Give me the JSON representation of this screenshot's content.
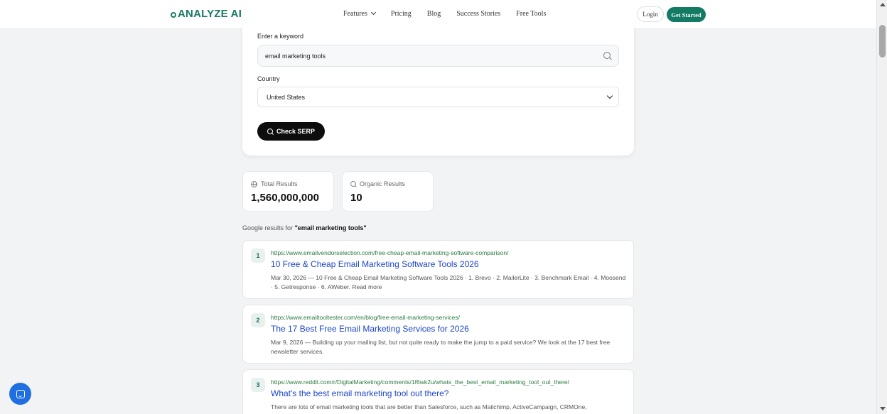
{
  "nav": {
    "logo": "ANALYZE AI",
    "links": [
      "Features",
      "Pricing",
      "Blog",
      "Success Stories",
      "Free Tools"
    ],
    "login": "Login",
    "get_started": "Get Started"
  },
  "form": {
    "keyword_label": "Enter a keyword",
    "keyword_value": "email marketing tools",
    "country_label": "Country",
    "country_value": "United States",
    "submit": "Check SERP"
  },
  "stats": {
    "total_label": "Total Results",
    "total_value": "1,560,000,000",
    "organic_label": "Organic Results",
    "organic_value": "10"
  },
  "results_caption": {
    "prefix": "Google results for",
    "query": "\"email marketing tools\""
  },
  "results": [
    {
      "rank": "1",
      "url": "https://www.emailvendorselection.com/free-cheap-email-marketing-software-comparison/",
      "title": "10 Free & Cheap Email Marketing Software Tools 2026",
      "snippet": "Mar 30, 2026 — 10 Free & Cheap Email Marketing Software Tools 2026 · 1. Brevo · 2. MailerLite · 3. Benchmark Email · 4. Moosend · 5. Getresponse · 6. AWeber. Read more"
    },
    {
      "rank": "2",
      "url": "https://www.emailtooltester.com/en/blog/free-email-marketing-services/",
      "title": "The 17 Best Free Email Marketing Services for 2026",
      "snippet": "Mar 9, 2026 — Building up your mailing list, but not quite ready to make the jump to a paid service? We look at the 17 best free newsletter services."
    },
    {
      "rank": "3",
      "url": "https://www.reddit.com/r/DigitalMarketing/comments/1f6wk2u/whats_the_best_email_marketing_tool_out_there/",
      "title": "What's the best email marketing tool out there?",
      "snippet": "There are lots of email marketing tools that are better than Salesforce, such as Mailchimp, ActiveCampaign, CRMOne,"
    }
  ],
  "colors": {
    "brand": "#137a63",
    "link": "#1c46c7",
    "url": "#2b7a3f",
    "chat": "#1f6fe0"
  }
}
